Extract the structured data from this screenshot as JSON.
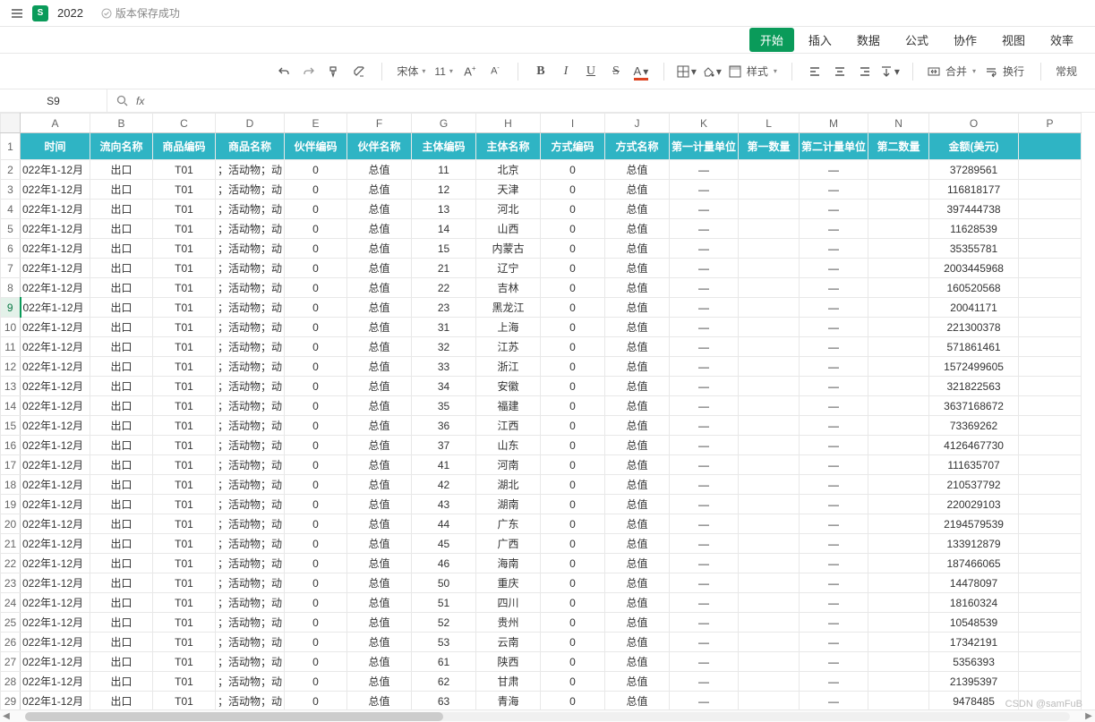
{
  "titlebar": {
    "doc_title": "2022",
    "save_status": "版本保存成功"
  },
  "menutabs": {
    "items": [
      {
        "label": "开始",
        "active": true
      },
      {
        "label": "插入"
      },
      {
        "label": "数据"
      },
      {
        "label": "公式"
      },
      {
        "label": "协作"
      },
      {
        "label": "视图"
      },
      {
        "label": "效率"
      }
    ]
  },
  "toolbar": {
    "font_name": "宋体",
    "font_size": "11",
    "style_label": "样式",
    "merge_label": "合并",
    "wrap_label": "换行",
    "format_label": "常规"
  },
  "formula_bar": {
    "cell_ref": "S9",
    "fx": "fx",
    "value": ""
  },
  "watermark": "CSDN @samFuB",
  "columns": [
    "A",
    "B",
    "C",
    "D",
    "E",
    "F",
    "G",
    "H",
    "I",
    "J",
    "K",
    "L",
    "M",
    "N",
    "O",
    "P"
  ],
  "col_classes": [
    "cA",
    "cB",
    "cC",
    "cD",
    "cE",
    "cF",
    "cG",
    "cH",
    "cI",
    "cJ",
    "cK",
    "cL",
    "cM",
    "cN",
    "cO",
    "cP"
  ],
  "headers": [
    "时间",
    "流向名称",
    "商品编码",
    "商品名称",
    "伙伴编码",
    "伙伴名称",
    "主体编码",
    "主体名称",
    "方式编码",
    "方式名称",
    "第一计量单位",
    "第一数量",
    "第二计量单位",
    "第二数量",
    "金额(美元)"
  ],
  "selected_row": 9,
  "rows": [
    {
      "n": 2,
      "g": "11",
      "h": "北京",
      "o": "37289561"
    },
    {
      "n": 3,
      "g": "12",
      "h": "天津",
      "o": "116818177"
    },
    {
      "n": 4,
      "g": "13",
      "h": "河北",
      "o": "397444738"
    },
    {
      "n": 5,
      "g": "14",
      "h": "山西",
      "o": "11628539"
    },
    {
      "n": 6,
      "g": "15",
      "h": "内蒙古",
      "o": "35355781"
    },
    {
      "n": 7,
      "g": "21",
      "h": "辽宁",
      "o": "2003445968"
    },
    {
      "n": 8,
      "g": "22",
      "h": "吉林",
      "o": "160520568"
    },
    {
      "n": 9,
      "g": "23",
      "h": "黑龙江",
      "o": "20041171"
    },
    {
      "n": 10,
      "g": "31",
      "h": "上海",
      "o": "221300378"
    },
    {
      "n": 11,
      "g": "32",
      "h": "江苏",
      "o": "571861461"
    },
    {
      "n": 12,
      "g": "33",
      "h": "浙江",
      "o": "1572499605"
    },
    {
      "n": 13,
      "g": "34",
      "h": "安徽",
      "o": "321822563"
    },
    {
      "n": 14,
      "g": "35",
      "h": "福建",
      "o": "3637168672"
    },
    {
      "n": 15,
      "g": "36",
      "h": "江西",
      "o": "73369262"
    },
    {
      "n": 16,
      "g": "37",
      "h": "山东",
      "o": "4126467730"
    },
    {
      "n": 17,
      "g": "41",
      "h": "河南",
      "o": "111635707"
    },
    {
      "n": 18,
      "g": "42",
      "h": "湖北",
      "o": "210537792"
    },
    {
      "n": 19,
      "g": "43",
      "h": "湖南",
      "o": "220029103"
    },
    {
      "n": 20,
      "g": "44",
      "h": "广东",
      "o": "2194579539"
    },
    {
      "n": 21,
      "g": "45",
      "h": "广西",
      "o": "133912879"
    },
    {
      "n": 22,
      "g": "46",
      "h": "海南",
      "o": "187466065"
    },
    {
      "n": 23,
      "g": "50",
      "h": "重庆",
      "o": "14478097"
    },
    {
      "n": 24,
      "g": "51",
      "h": "四川",
      "o": "18160324"
    },
    {
      "n": 25,
      "g": "52",
      "h": "贵州",
      "o": "10548539"
    },
    {
      "n": 26,
      "g": "53",
      "h": "云南",
      "o": "17342191"
    },
    {
      "n": 27,
      "g": "61",
      "h": "陕西",
      "o": "5356393"
    },
    {
      "n": 28,
      "g": "62",
      "h": "甘肃",
      "o": "21395397"
    },
    {
      "n": 29,
      "g": "63",
      "h": "青海",
      "o": "9478485"
    }
  ],
  "row_common": {
    "a": "022年1-12月",
    "b": "出口",
    "c": "T01",
    "d": "；活动物；动",
    "e": "0",
    "f": "总值",
    "i": "0",
    "j": "总值",
    "k": "—",
    "l": "",
    "m": "—",
    "n": ""
  }
}
